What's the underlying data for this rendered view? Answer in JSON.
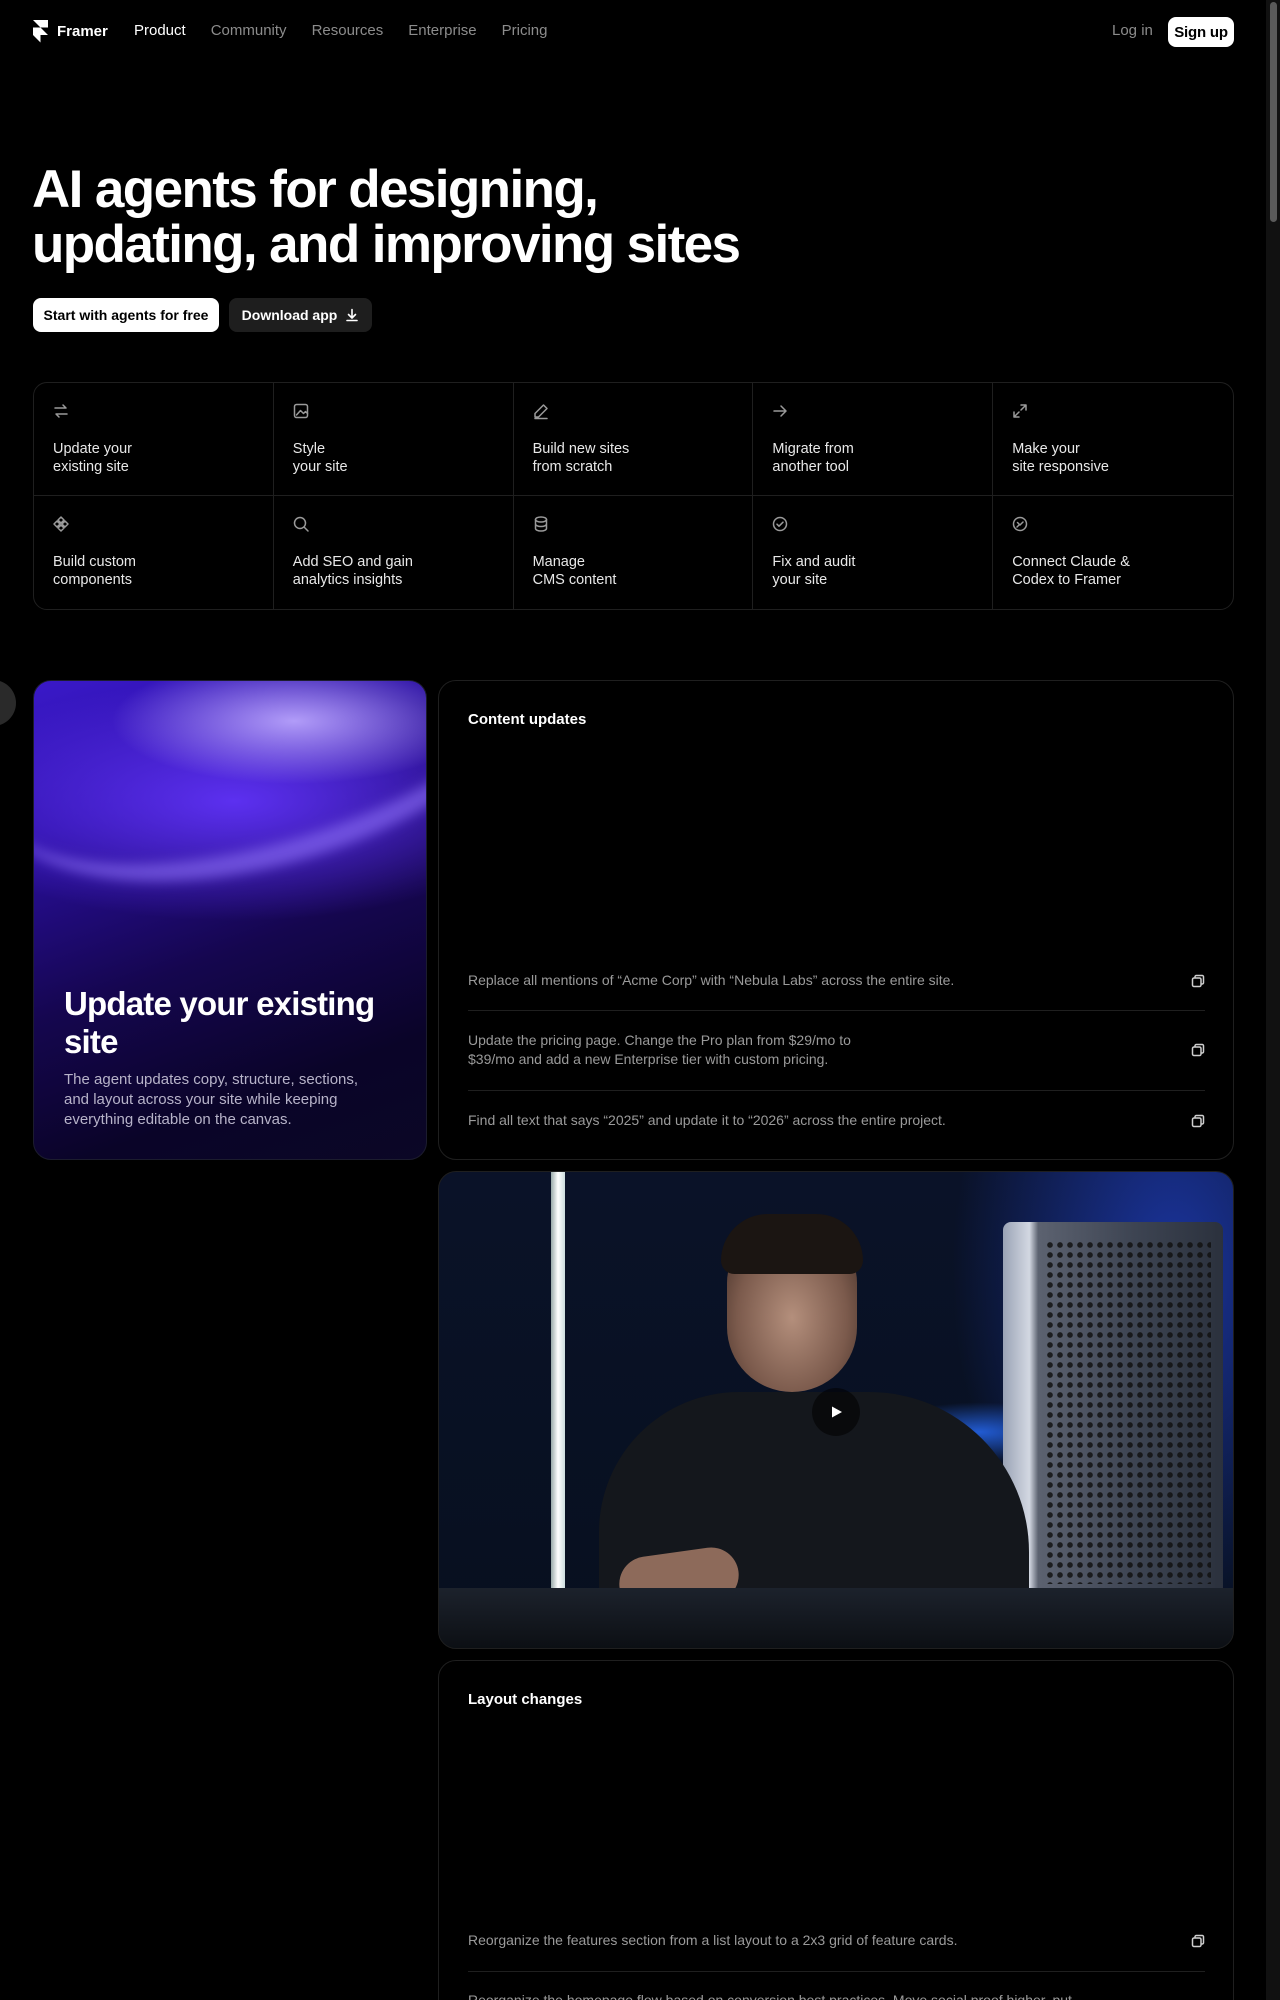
{
  "nav": {
    "brand": "Framer",
    "links": [
      "Product",
      "Community",
      "Resources",
      "Enterprise",
      "Pricing"
    ],
    "active": "Product",
    "login": "Log in",
    "signup": "Sign up"
  },
  "hero": {
    "title": "AI agents for designing, updating, and improving sites",
    "cta_primary": "Start with agents for free",
    "cta_secondary": "Download app"
  },
  "features": [
    {
      "label": "Update your\nexisting site",
      "icon": "arrows-swap-icon"
    },
    {
      "label": "Style\nyour site",
      "icon": "image-icon"
    },
    {
      "label": "Build new sites\nfrom scratch",
      "icon": "pencil-icon"
    },
    {
      "label": "Migrate from\nanother tool",
      "icon": "arrow-right-icon"
    },
    {
      "label": "Make your\nsite responsive",
      "icon": "expand-icon"
    },
    {
      "label": "Build custom\ncomponents",
      "icon": "component-icon"
    },
    {
      "label": "Add SEO and gain\nanalytics insights",
      "icon": "search-icon"
    },
    {
      "label": "Manage\nCMS content",
      "icon": "database-icon"
    },
    {
      "label": "Fix and audit\nyour site",
      "icon": "check-circle-icon"
    },
    {
      "label": "Connect Claude &\nCodex to Framer",
      "icon": "plugin-icon"
    }
  ],
  "feature_card": {
    "title": "Update your existing site",
    "description": "The agent updates copy, structure, sections, and layout across your site while keeping everything editable on the canvas."
  },
  "content_updates": {
    "title": "Content updates",
    "prompts": [
      "Replace all mentions of “Acme Corp” with “Nebula Labs” across the entire site.",
      "Update the pricing page. Change the Pro plan from $29/mo to $39/mo and add a new Enterprise tier with custom pricing.",
      "Find all text that says “2025” and update it to “2026” across the entire project."
    ]
  },
  "layout_changes": {
    "title": "Layout changes",
    "prompts": [
      "Reorganize the features section from a list layout to a 2x3 grid of feature cards.",
      "Reorganize the homepage flow based on conversion best practices. Move social proof higher, put"
    ]
  }
}
